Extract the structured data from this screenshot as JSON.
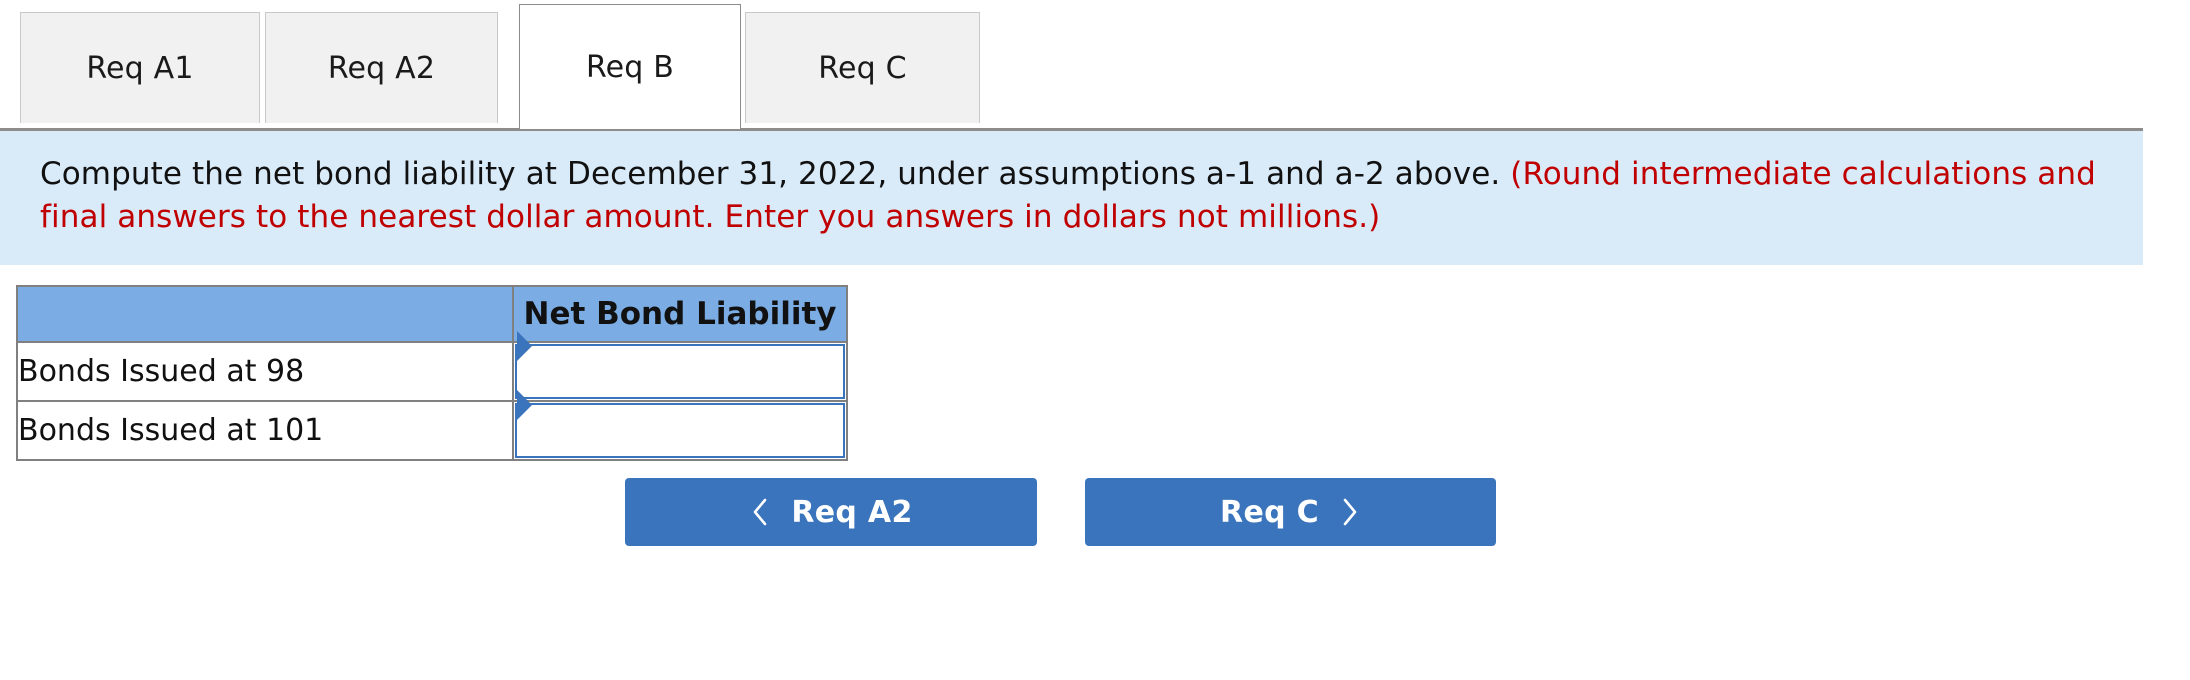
{
  "tabs": [
    {
      "label": "Req A1",
      "active": false
    },
    {
      "label": "Req A2",
      "active": false
    },
    {
      "label": "Req B",
      "active": true
    },
    {
      "label": "Req C",
      "active": false
    }
  ],
  "instruction": {
    "main": "Compute the net bond liability at December 31, 2022, under assumptions a-1 and a-2 above.",
    "note": "(Round intermediate calculations and final answers to the nearest dollar amount. Enter you answers in dollars not millions.)"
  },
  "table": {
    "headers": [
      "",
      "Net Bond Liability"
    ],
    "rows": [
      {
        "label": "Bonds Issued at 98",
        "value": "",
        "placeholder": ""
      },
      {
        "label": "Bonds Issued at 101",
        "value": "",
        "placeholder": ""
      }
    ]
  },
  "nav": {
    "prev_label": "Req A2",
    "prev_icon": "chevron-left-icon",
    "next_label": "Req C",
    "next_icon": "chevron-right-icon"
  },
  "colors": {
    "instruction_bg": "#d9eaf8",
    "note_text": "#c00000",
    "table_header_bg": "#7bace4",
    "button_bg": "#3a74bc",
    "active_tab_bg": "#ffffff",
    "inactive_tab_bg": "#f1f1f1",
    "border_gray": "#808080"
  }
}
